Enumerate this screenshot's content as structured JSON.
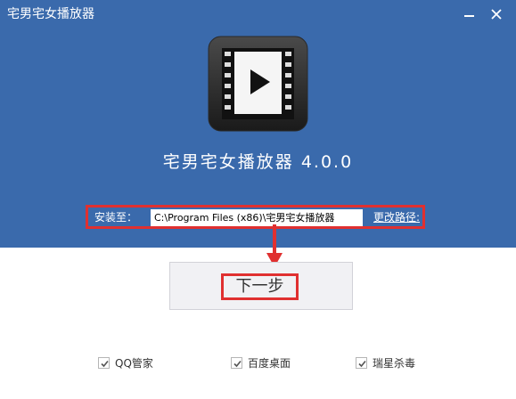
{
  "window": {
    "title": "宅男宅女播放器"
  },
  "app": {
    "name": "宅男宅女播放器 4.0.0",
    "icon": "video-play-icon"
  },
  "install": {
    "label": "安装至：",
    "path": "C:\\Program Files (x86)\\宅男宅女播放器",
    "change_path": "更改路径:"
  },
  "next_button": {
    "label": "下一步"
  },
  "options": [
    {
      "label": "QQ管家",
      "checked": true
    },
    {
      "label": "百度桌面",
      "checked": true
    },
    {
      "label": "瑞星杀毒",
      "checked": true
    }
  ],
  "colors": {
    "header_bg": "#3a6aac",
    "highlight": "#e03030"
  }
}
